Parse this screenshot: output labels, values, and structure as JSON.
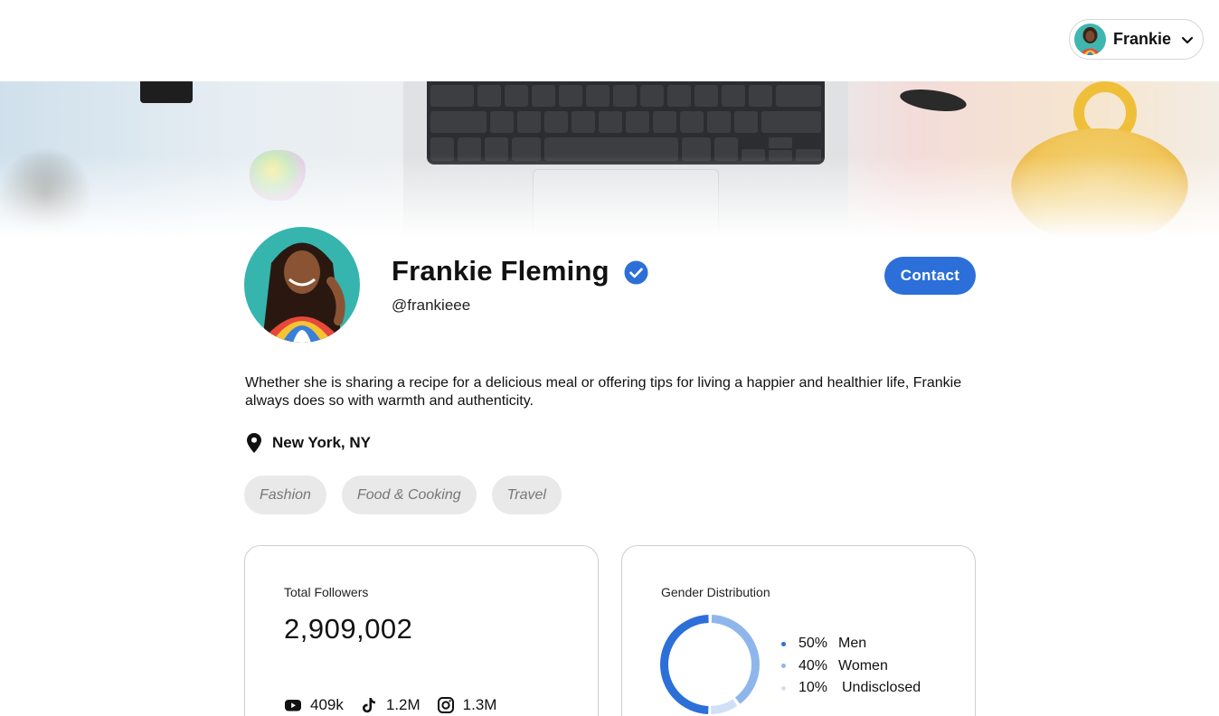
{
  "header": {
    "user_name": "Frankie"
  },
  "profile": {
    "name": "Frankie Fleming",
    "handle": "@frankieee",
    "contact_label": "Contact",
    "bio": "Whether she is sharing a recipe for a delicious meal or offering tips for living a happier and healthier life, Frankie always does so with warmth and authenticity.",
    "location": "New York, NY",
    "tags": [
      "Fashion",
      "Food & Cooking",
      "Travel"
    ]
  },
  "followers": {
    "title": "Total Followers",
    "total": "2,909,002",
    "platforms": [
      {
        "icon": "youtube-icon",
        "value": "409k"
      },
      {
        "icon": "tiktok-icon",
        "value": "1.2M"
      },
      {
        "icon": "instagram-icon",
        "value": "1.3M"
      }
    ]
  },
  "gender": {
    "title": "Gender Distribution",
    "items": [
      {
        "pct": "50%",
        "label": "Men",
        "color": "#2d6fd9"
      },
      {
        "pct": "40%",
        "label": "Women",
        "color": "#8fb6ec"
      },
      {
        "pct": "10%",
        "label": "Undisclosed",
        "color": "#cfe0f7"
      }
    ]
  },
  "colors": {
    "accent": "#2d6fd9",
    "tag_bg": "#e9e9e9"
  }
}
